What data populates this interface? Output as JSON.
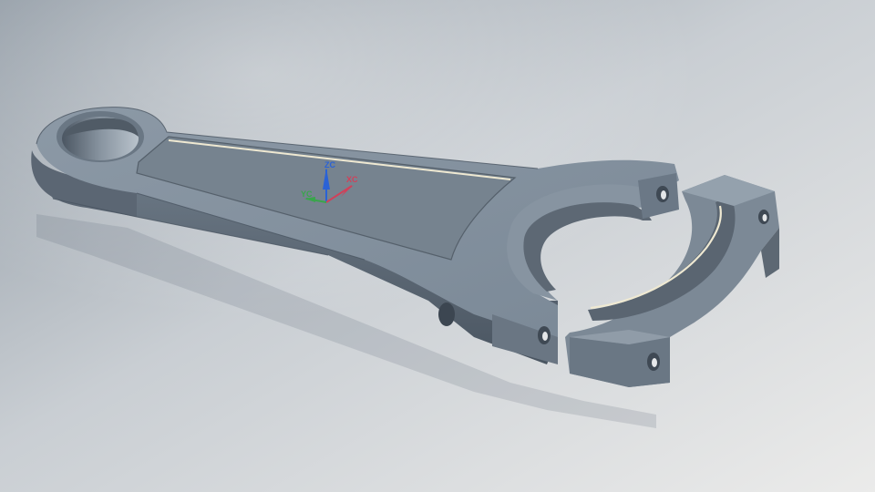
{
  "viewport": {
    "background_colors": [
      "#97a0a9",
      "#cdd1d6",
      "#e7e8e8"
    ]
  },
  "model": {
    "part": "connecting-rod",
    "body_color": "#7d8b99",
    "shadow_color": "#3f4954",
    "highlight_color": "#b4c0cb",
    "bearing_liner_color": "#efe9d2"
  },
  "triad": {
    "zc_label": "ZC",
    "xc_label": "XC",
    "yc_label": "YC",
    "colors": {
      "x": "#d0415a",
      "y": "#3aa54c",
      "z": "#2a62d6"
    }
  }
}
